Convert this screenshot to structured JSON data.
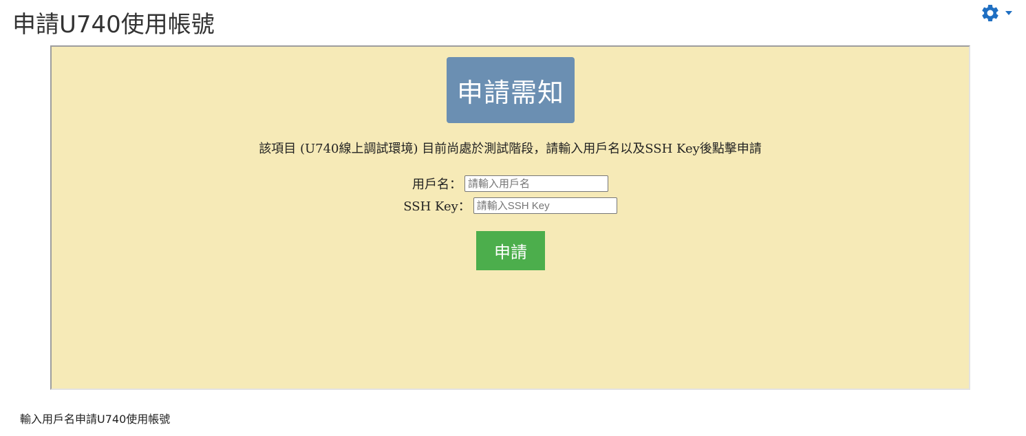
{
  "page": {
    "title": "申請U740使用帳號"
  },
  "settings_menu": {
    "icon": "gear-icon",
    "caret_icon": "caret-down-icon",
    "accent_color": "#1f6fc2"
  },
  "panel": {
    "background_color": "#f6eab7",
    "notice_badge": {
      "label": "申請需知",
      "color": "#6b8fb2"
    },
    "notice_text": "該項目 (U740線上調試環境) 目前尚處於測試階段，請輸入用戶名以及SSH Key後點擊申請",
    "form": {
      "username": {
        "label": "用戶名：",
        "value": "",
        "placeholder": "請輸入用戶名"
      },
      "ssh_key": {
        "label": "SSH Key：",
        "value": "",
        "placeholder": "請輸入SSH Key"
      },
      "submit": {
        "label": "申請",
        "color": "#4cae4c"
      }
    }
  },
  "footer": {
    "text": "輸入用戶名申請U740使用帳號"
  }
}
